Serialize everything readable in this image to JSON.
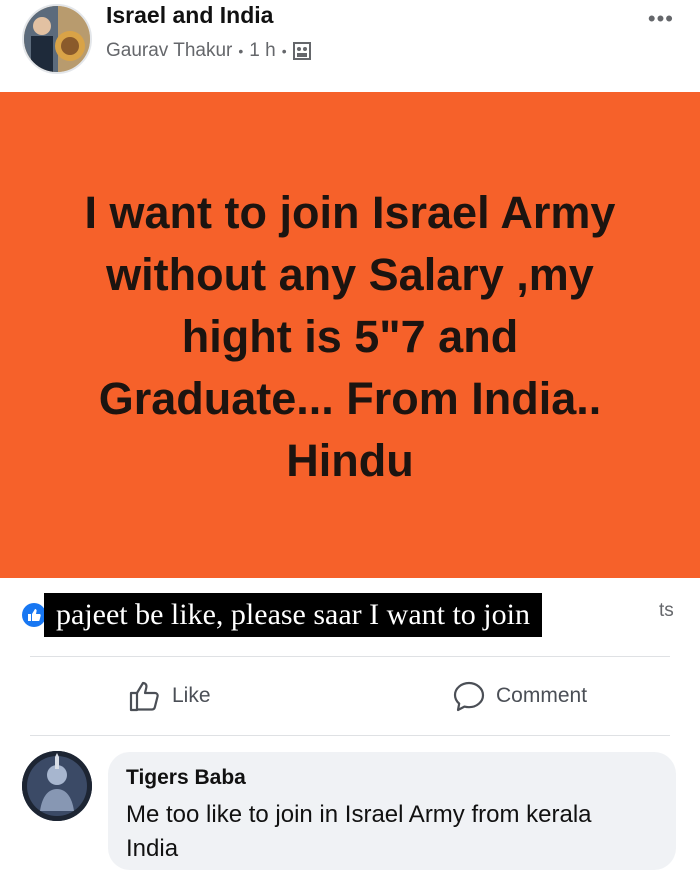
{
  "header": {
    "group_name": "Israel and India",
    "author": "Gaurav Thakur",
    "separator": "•",
    "time": "1 h",
    "privacy_icon": "group-privacy-icon",
    "more_icon": "more-options-icon",
    "more_label": "•••"
  },
  "post": {
    "background_color": "#f6612a",
    "text_lines": [
      "I want to join Israel Army",
      "without any Salary ,my",
      "hight is 5\"7 and",
      "Graduate... From India..",
      "Hindu"
    ]
  },
  "reactions": {
    "reaction_icon": "like-reaction-icon",
    "caption_overlay": "pajeet be like, please saar I want to join",
    "shares_fragment": "ts"
  },
  "actions": {
    "like_label": "Like",
    "like_icon": "thumbs-up-icon",
    "comment_label": "Comment",
    "comment_icon": "comment-bubble-icon"
  },
  "comment": {
    "author": "Tigers Baba",
    "text": "Me too like to join in Israel Army from kerala India"
  }
}
